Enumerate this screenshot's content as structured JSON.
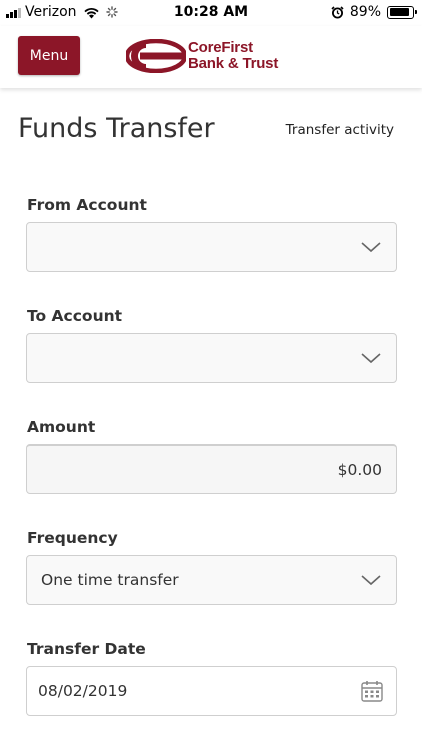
{
  "status_bar": {
    "carrier": "Verizon",
    "time": "10:28 AM",
    "battery": "89%",
    "battery_level": 0.89
  },
  "header": {
    "menu_label": "Menu",
    "logo_line1": "CoreFirst",
    "logo_line2": "Bank & Trust",
    "brand_color": "#8c1628"
  },
  "page": {
    "title": "Funds Transfer",
    "activity_link": "Transfer activity"
  },
  "form": {
    "from_account": {
      "label": "From Account",
      "value": ""
    },
    "to_account": {
      "label": "To Account",
      "value": ""
    },
    "amount": {
      "label": "Amount",
      "value": "$0.00"
    },
    "frequency": {
      "label": "Frequency",
      "value": "One time transfer"
    },
    "transfer_date": {
      "label": "Transfer Date",
      "value": "08/02/2019"
    }
  }
}
